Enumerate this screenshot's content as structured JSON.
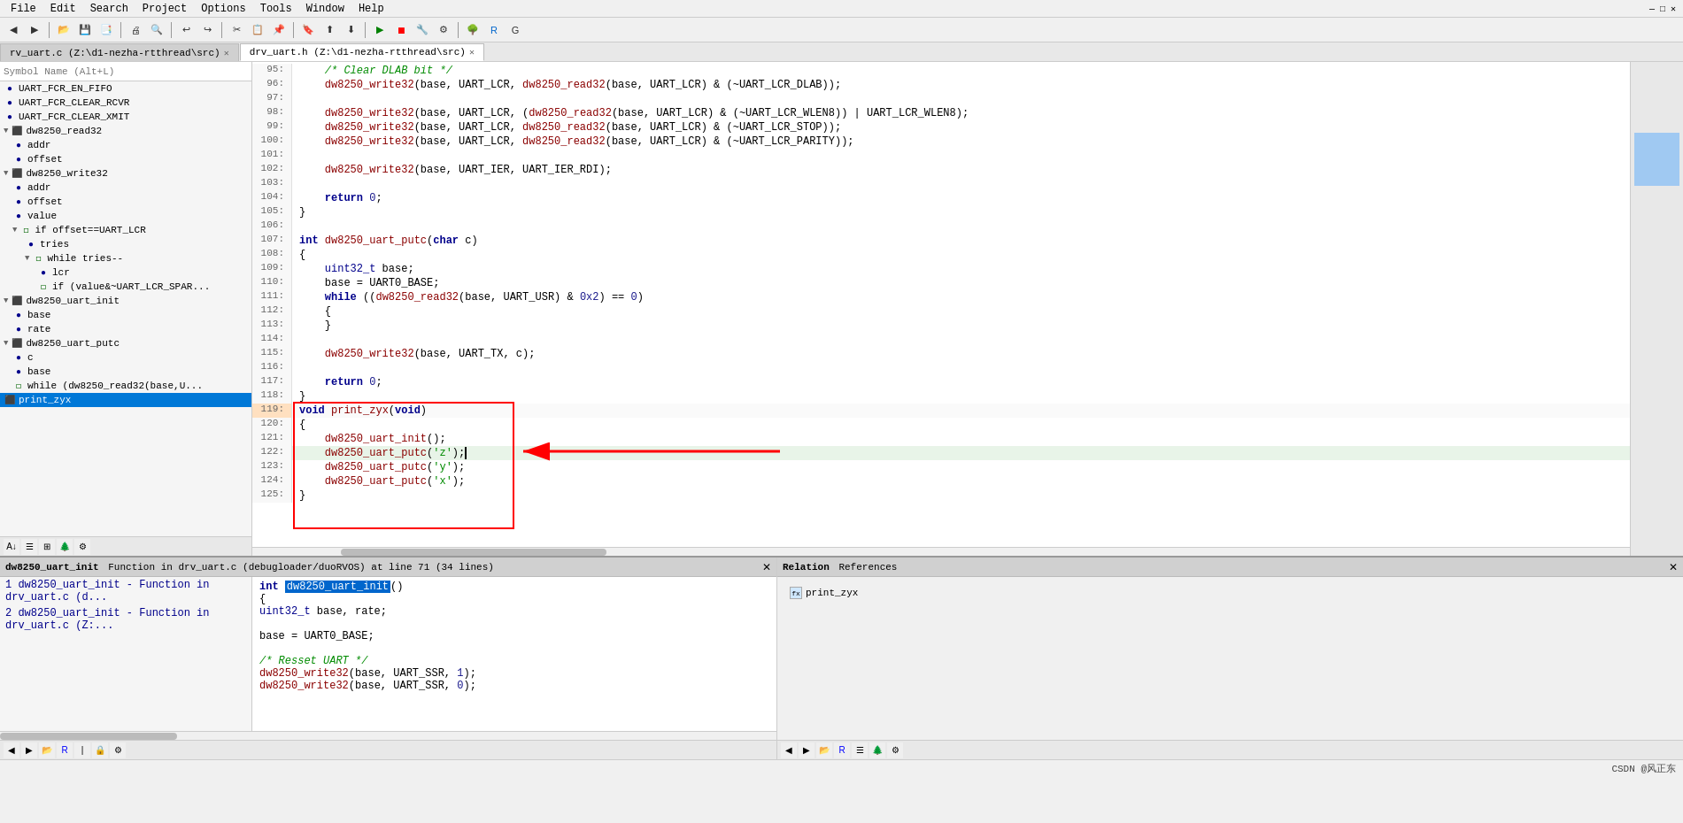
{
  "menubar": {
    "items": [
      "File",
      "Edit",
      "Search",
      "Project",
      "Options",
      "Tools",
      "Window",
      "Help"
    ]
  },
  "tabs": {
    "items": [
      {
        "label": "rv_uart.c (Z:\\d1-nezha-rtthread\\src)",
        "active": false
      },
      {
        "label": "drv_uart.h (Z:\\d1-nezha-rtthread\\src)",
        "active": true
      }
    ]
  },
  "search_placeholder": "Symbol Name (Alt+L)",
  "symbol_tree": {
    "items": [
      {
        "id": "uart_fcr_en_fifo",
        "label": "UART_FCR_EN_FIFO",
        "type": "var",
        "indent": 0
      },
      {
        "id": "uart_fcr_clear_rcvr",
        "label": "UART_FCR_CLEAR_RCVR",
        "type": "var",
        "indent": 0
      },
      {
        "id": "uart_fcr_clear_xmit",
        "label": "UART_FCR_CLEAR_XMIT",
        "type": "var",
        "indent": 0
      },
      {
        "id": "dw8250_read32",
        "label": "dw8250_read32",
        "type": "func",
        "indent": 0
      },
      {
        "id": "addr",
        "label": "addr",
        "type": "var",
        "indent": 1
      },
      {
        "id": "offset1",
        "label": "offset",
        "type": "var",
        "indent": 1
      },
      {
        "id": "dw8250_write32",
        "label": "dw8250_write32",
        "type": "func",
        "indent": 0
      },
      {
        "id": "addr2",
        "label": "addr",
        "type": "var",
        "indent": 1
      },
      {
        "id": "offset2",
        "label": "offset",
        "type": "var",
        "indent": 1
      },
      {
        "id": "value",
        "label": "value",
        "type": "var",
        "indent": 1
      },
      {
        "id": "if_offset",
        "label": "if offset==UART_LCR",
        "type": "block",
        "indent": 1
      },
      {
        "id": "tries",
        "label": "tries",
        "type": "var",
        "indent": 2
      },
      {
        "id": "while_tries",
        "label": "while tries--",
        "type": "block",
        "indent": 2
      },
      {
        "id": "lcr",
        "label": "lcr",
        "type": "var",
        "indent": 3
      },
      {
        "id": "if_value",
        "label": "if (value&~UART_LCR_SPAR...",
        "type": "block",
        "indent": 3
      },
      {
        "id": "dw8250_uart_init",
        "label": "dw8250_uart_init",
        "type": "func",
        "indent": 0
      },
      {
        "id": "base1",
        "label": "base",
        "type": "var",
        "indent": 1
      },
      {
        "id": "rate",
        "label": "rate",
        "type": "var",
        "indent": 1
      },
      {
        "id": "dw8250_uart_putc",
        "label": "dw8250_uart_putc",
        "type": "func",
        "indent": 0
      },
      {
        "id": "c",
        "label": "c",
        "type": "var",
        "indent": 1
      },
      {
        "id": "base2",
        "label": "base",
        "type": "var",
        "indent": 1
      },
      {
        "id": "while_read32",
        "label": "while (dw8250_read32(base,U...",
        "type": "block",
        "indent": 1
      },
      {
        "id": "print_zyx",
        "label": "print_zyx",
        "type": "func",
        "indent": 0,
        "selected": true
      }
    ]
  },
  "code_lines": [
    {
      "num": "95:",
      "content": "    /* Clear DLAB bit */",
      "type": "comment"
    },
    {
      "num": "96:",
      "content": "    dw8250_write32(base, UART_LCR, dw8250_read32(base, UART_LCR) & (~UART_LCR_DLAB));",
      "type": "code"
    },
    {
      "num": "97:",
      "content": "",
      "type": "empty"
    },
    {
      "num": "98:",
      "content": "    dw8250_write32(base, UART_LCR, (dw8250_read32(base, UART_LCR) & (~UART_LCR_WLEN8)) | UART_LCR_WLEN8);",
      "type": "code"
    },
    {
      "num": "99:",
      "content": "    dw8250_write32(base, UART_LCR, dw8250_read32(base, UART_LCR) & (~UART_LCR_STOP));",
      "type": "code"
    },
    {
      "num": "100:",
      "content": "    dw8250_write32(base, UART_LCR, dw8250_read32(base, UART_LCR) & (~UART_LCR_PARITY));",
      "type": "code"
    },
    {
      "num": "101:",
      "content": "",
      "type": "empty"
    },
    {
      "num": "102:",
      "content": "    dw8250_write32(base, UART_IER, UART_IER_RDI);",
      "type": "code"
    },
    {
      "num": "103:",
      "content": "",
      "type": "empty"
    },
    {
      "num": "104:",
      "content": "    return 0;",
      "type": "code"
    },
    {
      "num": "105:",
      "content": "}",
      "type": "code"
    },
    {
      "num": "106:",
      "content": "",
      "type": "empty"
    },
    {
      "num": "107:",
      "content": "int dw8250_uart_putc(char c)",
      "type": "code"
    },
    {
      "num": "108:",
      "content": "{",
      "type": "code"
    },
    {
      "num": "109:",
      "content": "    uint32_t base;",
      "type": "code"
    },
    {
      "num": "110:",
      "content": "    base = UART0_BASE;",
      "type": "code"
    },
    {
      "num": "111:",
      "content": "    while ((dw8250_read32(base, UART_USR) & 0x2) == 0)",
      "type": "code"
    },
    {
      "num": "112:",
      "content": "    {",
      "type": "code"
    },
    {
      "num": "113:",
      "content": "    }",
      "type": "code"
    },
    {
      "num": "114:",
      "content": "",
      "type": "empty"
    },
    {
      "num": "115:",
      "content": "    dw8250_write32(base, UART_TX, c);",
      "type": "code"
    },
    {
      "num": "116:",
      "content": "",
      "type": "empty"
    },
    {
      "num": "117:",
      "content": "    return 0;",
      "type": "code"
    },
    {
      "num": "118:",
      "content": "}",
      "type": "code"
    },
    {
      "num": "119:",
      "content": "void print_zyx(void)",
      "type": "code",
      "highlight": true
    },
    {
      "num": "120:",
      "content": "{",
      "type": "code",
      "highlight": true
    },
    {
      "num": "121:",
      "content": "    dw8250_uart_init();",
      "type": "code",
      "highlight": true
    },
    {
      "num": "122:",
      "content": "    dw8250_uart_putc('z');",
      "type": "code",
      "highlight": true,
      "cursor": true
    },
    {
      "num": "123:",
      "content": "    dw8250_uart_putc('y');",
      "type": "code",
      "highlight": true
    },
    {
      "num": "124:",
      "content": "    dw8250_uart_putc('x');",
      "type": "code",
      "highlight": true
    },
    {
      "num": "125:",
      "content": "}",
      "type": "code",
      "highlight": true
    }
  ],
  "bottom_panel": {
    "title": "dw8250_uart_init",
    "subtitle": "Function in drv_uart.c (debugloader/duoRVOS) at line 71 (34 lines)",
    "list_items": [
      "1  dw8250_uart_init - Function in drv_uart.c (d...",
      "2  dw8250_uart_init - Function in drv_uart.c (Z:..."
    ],
    "code_lines": [
      {
        "content": "int dw8250_uart_init()",
        "bold_part": "dw8250_uart_init",
        "type": "func_decl"
      },
      {
        "content": "{",
        "type": "normal"
      },
      {
        "content": "    uint32_t base, rate;",
        "type": "normal"
      },
      {
        "content": "",
        "type": "empty"
      },
      {
        "content": "    base = UART0_BASE;",
        "type": "normal"
      },
      {
        "content": "",
        "type": "empty"
      },
      {
        "content": "    /* Resset UART */",
        "type": "comment"
      },
      {
        "content": "    dw8250_write32(base, UART_SSR, 1);",
        "type": "code"
      },
      {
        "content": "    dw8250_write32(base, UART_SSR, 0);",
        "type": "code"
      }
    ]
  },
  "relations_panel": {
    "title": "Relation",
    "subtitle": "References",
    "items": [
      {
        "label": "print_zyx"
      }
    ]
  },
  "status_bar": {
    "text": "CSDN @风正东"
  },
  "bottom_int_label": "int"
}
